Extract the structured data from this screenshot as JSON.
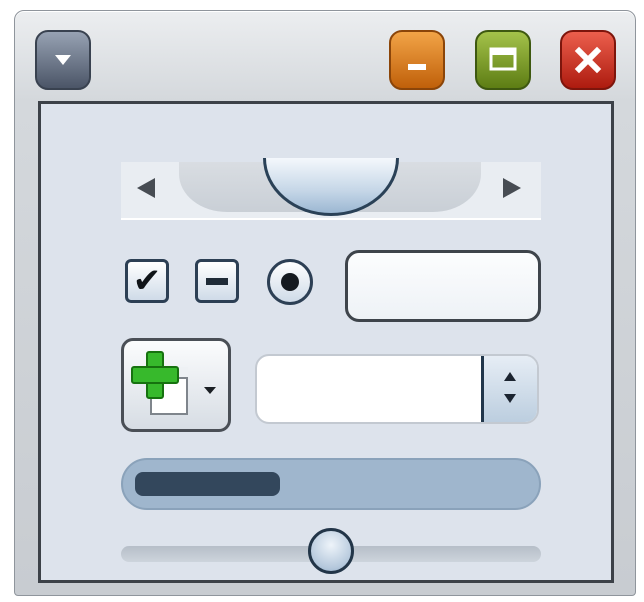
{
  "window": {
    "controls": {
      "menu_icon": "triangle-down-icon",
      "minimize_icon": "minimize-icon",
      "maximize_icon": "maximize-icon",
      "close_icon": "close-icon"
    },
    "accent_colors": {
      "minimize": "#e07a1f",
      "maximize": "#7a9a2a",
      "close": "#cf3325",
      "frame": "#3c4148"
    }
  },
  "content": {
    "scrollbar": {
      "left_icon": "arrow-left-icon",
      "right_icon": "arrow-right-icon",
      "thumb_position": 0.5
    },
    "checkbox_checked": {
      "state": "checked",
      "icon": "checkmark-icon",
      "glyph": "✔"
    },
    "checkbox_indeterminate": {
      "state": "indeterminate",
      "icon": "dash-icon"
    },
    "radio": {
      "state": "selected",
      "icon": "radio-dot-icon"
    },
    "text_field": {
      "value": ""
    },
    "new_document_button": {
      "icon": "new-document-icon",
      "dropdown_icon": "caret-down-icon"
    },
    "spinner": {
      "value": "",
      "up_icon": "spin-up-icon",
      "down_icon": "spin-down-icon"
    },
    "progress": {
      "value": 0.37,
      "fill_color": "#33475c",
      "track_color": "#9fb6cd"
    },
    "slider": {
      "value": 0.5
    }
  }
}
